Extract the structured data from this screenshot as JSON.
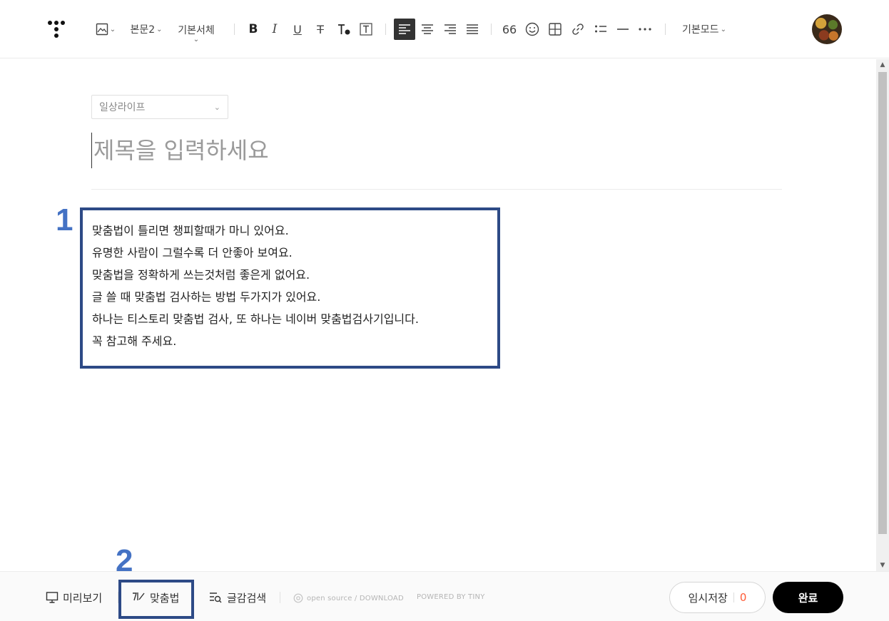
{
  "toolbar": {
    "paragraph_style": "본문2",
    "font_family": "기본서체",
    "quote_label": "66",
    "mode_label": "기본모드"
  },
  "editor": {
    "category_value": "일상라이프",
    "title_placeholder": "제목을 입력하세요",
    "body_lines": [
      "맞춤법이 틀리면 챙피할때가 마니 있어요.",
      "유명한 사람이 그럴수록 더 안좋아 보여요.",
      "맞춤법을 정확하게 쓰는것처럼 좋은게 없어요.",
      "글 쓸 때 맞춤법 검사하는 방법 두가지가 있어요.",
      "하나는 티스토리 맞춤법 검사, 또 하나는 네이버 맞춤법검사기입니다.",
      "꼭 참고해 주세요."
    ]
  },
  "annotations": {
    "box1_number": "1",
    "box2_number": "2"
  },
  "bottombar": {
    "preview_label": "미리보기",
    "spellcheck_label": "맞춤법",
    "search_label": "글감검색",
    "credit_opensource": "open source / DOWNLOAD",
    "credit_powered": "POWERED BY TINY",
    "temp_save_label": "임시저장",
    "temp_save_count": "0",
    "done_label": "완료"
  },
  "colors": {
    "annotation_box": "#2d4a86",
    "annotation_number": "#4472c4",
    "temp_save_count": "#ff5a36",
    "done_button": "#000000"
  }
}
